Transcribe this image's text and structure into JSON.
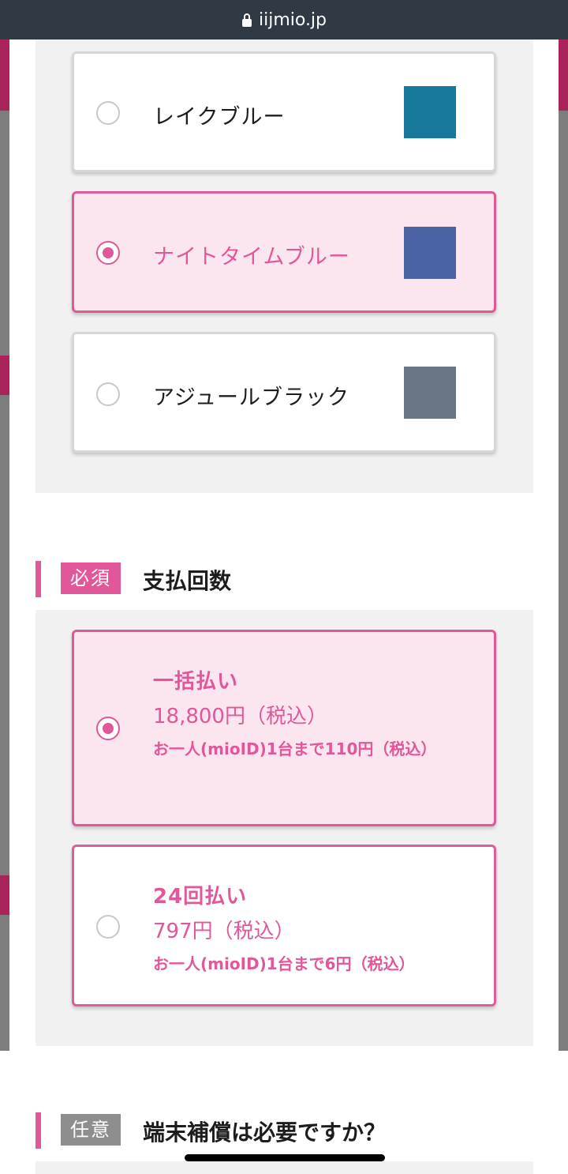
{
  "browser": {
    "url": "iijmio.jp"
  },
  "color_options": [
    {
      "label": "レイクブルー",
      "selected": false,
      "swatch": "#17789b"
    },
    {
      "label": "ナイトタイムブルー",
      "selected": true,
      "swatch": "#4a63a5"
    },
    {
      "label": "アジュールブラック",
      "selected": false,
      "swatch": "#6a7585"
    }
  ],
  "payment_section": {
    "tag": "必須",
    "title": "支払回数",
    "options": [
      {
        "title": "一括払い",
        "price": "18,800円（税込）",
        "note": "お一人(mioID)1台まで110円（税込）",
        "selected": true
      },
      {
        "title": "24回払い",
        "price": "797円（税込）",
        "note": "お一人(mioID)1台まで6円（税込）",
        "selected": false
      }
    ]
  },
  "warranty_section": {
    "tag": "任意",
    "title": "端末補償は必要ですか？"
  },
  "colors": {
    "accent": "#e0579a",
    "selected_bg": "#fbe6f0",
    "panel_bg": "#f1f1f1"
  }
}
